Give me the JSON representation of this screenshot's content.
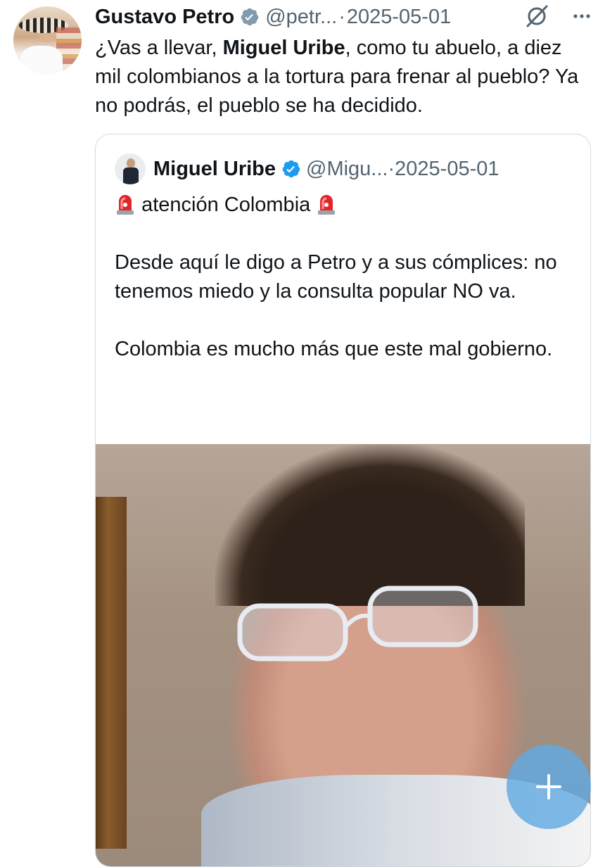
{
  "tweet": {
    "author_name": "Gustavo Petro",
    "handle": "@petr...",
    "separator": "·",
    "date": "2025-05-01",
    "text_before": "¿Vas a llevar, ",
    "text_bold": "Miguel Uribe",
    "text_after": ", como tu abuelo, a diez mil colombianos a la tortura para frenar al pueblo? Ya no podrás, el pueblo se ha decidido."
  },
  "quote": {
    "author_name": "Miguel Uribe",
    "handle": "@Migu...",
    "separator": "·",
    "date": "2025-05-01",
    "headline": "atención Colombia",
    "paragraph1": "Desde aquí le digo a Petro y a sus cómplices: no tenemos miedo y la consulta popular NO va.",
    "paragraph2": "Colombia es mucho más que este mal gobierno."
  },
  "icons": {
    "verified": "verified-badge-icon",
    "grok": "grok-icon",
    "more": "more-options-icon",
    "siren": "police-siren-icon",
    "compose": "plus-icon"
  },
  "colors": {
    "verified_blue": "#1d9bf0",
    "secondary_text": "#536471",
    "border": "#cfd9de",
    "fab": "#62aae2"
  }
}
